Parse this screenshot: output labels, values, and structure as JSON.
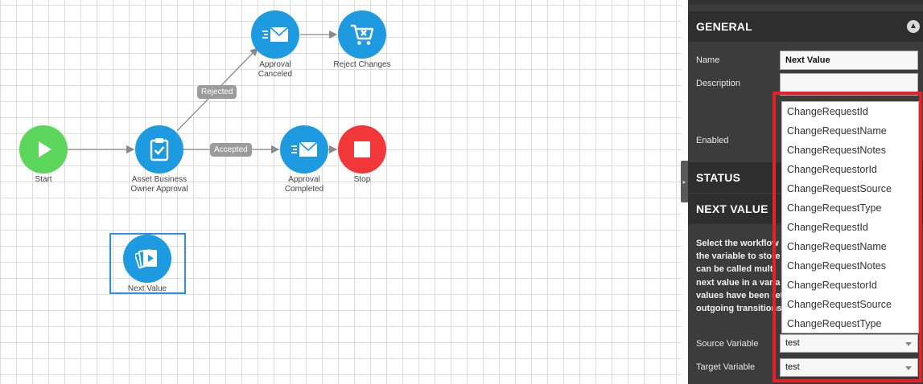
{
  "canvas": {
    "nodes": {
      "start": {
        "label": "Start",
        "icon": "play-icon"
      },
      "asset_approval": {
        "label_line1": "Asset Business",
        "label_line2": "Owner Approval",
        "icon": "clipboard-check-icon"
      },
      "approval_canceled": {
        "label_line1": "Approval",
        "label_line2": "Canceled",
        "icon": "email-send-icon"
      },
      "reject_changes": {
        "label": "Reject Changes",
        "icon": "cart-x-icon"
      },
      "approval_completed": {
        "label_line1": "Approval",
        "label_line2": "Completed",
        "icon": "email-send-icon"
      },
      "stop": {
        "label": "Stop",
        "icon": "stop-icon"
      },
      "next_value": {
        "label": "Next Value",
        "icon": "media-stack-icon"
      }
    },
    "edge_labels": {
      "rejected": "Rejected",
      "accepted": "Accepted"
    },
    "colors": {
      "activity": "#1e9be0",
      "start": "#5bd65b",
      "stop": "#f2373a",
      "selection": "#2f8fe8",
      "edge": "#9b9b9b"
    }
  },
  "panel": {
    "general": {
      "title": "GENERAL",
      "name_label": "Name",
      "name_value": "Next Value",
      "description_label": "Description",
      "enabled_label": "Enabled"
    },
    "status": {
      "title": "STATUS"
    },
    "next_value": {
      "title": "NEXT VALUE",
      "info_lines": [
        "Select the workflow v",
        "the variable to store",
        "can be called multi",
        "next value in a varia",
        "values have been ret",
        "outgoing transitions"
      ],
      "source_label": "Source Variable",
      "source_value": "test",
      "target_label": "Target Variable",
      "target_value": "test"
    }
  },
  "dropdown": {
    "options": [
      "ChangeRequestId",
      "ChangeRequestName",
      "ChangeRequestNotes",
      "ChangeRequestorId",
      "ChangeRequestSource",
      "ChangeRequestType",
      "ChangeRequestId",
      "ChangeRequestName",
      "ChangeRequestNotes",
      "ChangeRequestorId",
      "ChangeRequestSource",
      "ChangeRequestType"
    ],
    "highlight_color": "#e8202a"
  }
}
